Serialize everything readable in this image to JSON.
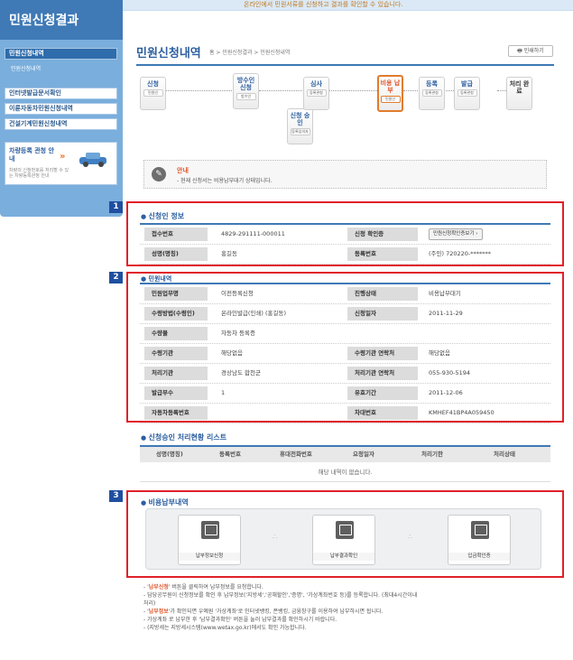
{
  "top_banner": "온라인에서 민원서류를 신청하고 결과를 확인할 수 있습니다.",
  "sidebar": {
    "title": "민원신청결과",
    "items": [
      {
        "label": "민원신청내역"
      },
      {
        "label": "민원신청내역"
      },
      {
        "label": "인터넷발급문서확인"
      },
      {
        "label": "이륜자동차민원신청내역"
      },
      {
        "label": "건설기계민원신청내역"
      }
    ],
    "car_banner": {
      "title": "차량등록 관청 안내",
      "desc": "차량의 신청번호를 처리할 수 있는 차량등록관청 안내"
    }
  },
  "page": {
    "title": "민원신청내역",
    "breadcrumb": "홈 > 민원신청결과 > 민원신청내역",
    "print_label": "인쇄하기"
  },
  "flow": [
    {
      "label": "신청",
      "sub": "민원인"
    },
    {
      "label": "방수인 신청",
      "sub": "방수인"
    },
    {
      "label": "신청 승인",
      "sub": "등록임의자"
    },
    {
      "label": "심사",
      "sub": "등록관청"
    },
    {
      "label": "비용 납부",
      "sub": "민원인"
    },
    {
      "label": "등록",
      "sub": "등록관청"
    },
    {
      "label": "발급",
      "sub": "등록관청"
    },
    {
      "label": "처리 완료",
      "sub": ""
    }
  ],
  "notice": {
    "title": "안내",
    "text": "- 현재 신청서는 비용납부대기 상태입니다."
  },
  "badges": [
    "1",
    "2",
    "3"
  ],
  "applicant": {
    "section_title": "신청인 정보",
    "receipt_label": "접수번호",
    "receipt_value": "4829-291111-000011",
    "confirm_label": "신청 확인증",
    "confirm_button": "민원신청확인증보기 ›",
    "name_label": "성명(명칭)",
    "name_value": "홍길동",
    "regno_label": "등록번호",
    "regno_value": "(주민) 720220-*******"
  },
  "detail": {
    "section_title": "민원내역",
    "rows": [
      {
        "l1": "민원업무명",
        "v1": "이전등록신청",
        "l2": "진행상태",
        "v2": "비용납부대기"
      },
      {
        "l1": "수령방법(수령인)",
        "v1": "온라인발급(인쇄)  (홍길동)",
        "l2": "신청일자",
        "v2": "2011-11-29"
      },
      {
        "l1": "수량물",
        "v1": "자동차 등록증",
        "l2": "",
        "v2": ""
      },
      {
        "l1": "수령기관",
        "v1": "해당없음",
        "l2": "수령기관 연락처",
        "v2": "해당없음"
      },
      {
        "l1": "처리기관",
        "v1": "경상남도 합천군",
        "l2": "처리기관 연락처",
        "v2": "055-930-5194"
      },
      {
        "l1": "발급부수",
        "v1": "1",
        "l2": "유효기간",
        "v2": "2011-12-06"
      },
      {
        "l1": "자동차등록번호",
        "v1": "",
        "l2": "차대번호",
        "v2": "KMHEF41BP4A059450"
      }
    ]
  },
  "approval_list": {
    "section_title": "신청승인 처리현황 리스트",
    "columns": [
      "성명(명칭)",
      "등록번호",
      "휴대전화번호",
      "요청일자",
      "처리기한",
      "처리상태"
    ],
    "empty_text": "해당 내역이 없습니다."
  },
  "payment": {
    "section_title": "비용납부내역",
    "buttons": [
      "납부정보신청",
      "납부결과확인",
      "입금확인증"
    ]
  },
  "notes": [
    {
      "pre": "- '",
      "bold": "납부신청",
      "post": "' 버튼을 클릭하여 납부정보를 요청합니다."
    },
    {
      "pre": "- 담당공무원이 신청정보를 확인 후 납부정보('지방세','공채할인','증명', '가상계좌번호 등)를 등록합니다. (최대4시간이내",
      "bold": "",
      "post": ""
    },
    {
      "pre": "  처리)",
      "bold": "",
      "post": ""
    },
    {
      "pre": "- '",
      "bold": "납부정보",
      "post": "'가 확인되면 우예원 '가상계좌'로 인터넷뱅킹, 폰뱅킹, 금융창구를 이용하여 납부하시면 됩니다."
    },
    {
      "pre": "- 가상계좌 로 납부한 후 '납부결과확인' 버튼을 눌러 납부결과를 확인하시기 바랍니다.",
      "bold": "",
      "post": ""
    },
    {
      "pre": "- (지방세는 지방세시스템(www.wetax.go.kr)에서도 확인 가능합니다.",
      "bold": "",
      "post": ""
    }
  ]
}
